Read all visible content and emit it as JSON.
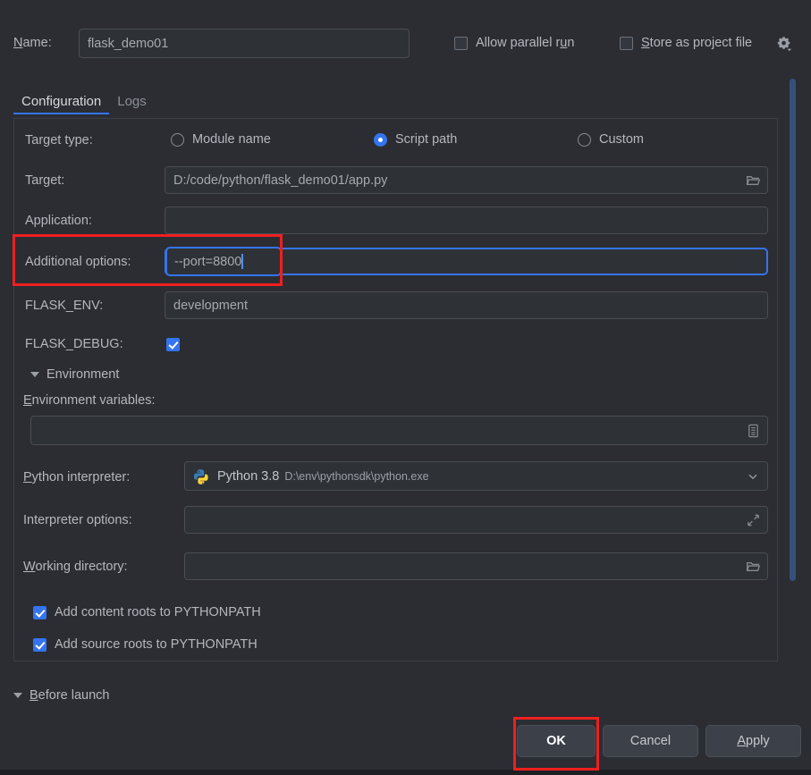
{
  "window": {
    "name_label": "Name:",
    "name_value": "flask_demo01",
    "allow_parallel_run": "Allow parallel run",
    "store_as_project_file": "Store as project file",
    "gear_icon": "gear-icon"
  },
  "tabs": [
    {
      "label": "Configuration",
      "active": true
    },
    {
      "label": "Logs",
      "active": false
    }
  ],
  "form": {
    "target_type_label": "Target type:",
    "target_type_options": [
      {
        "label": "Module name",
        "selected": false
      },
      {
        "label": "Script path",
        "selected": true
      },
      {
        "label": "Custom",
        "selected": false
      }
    ],
    "target_label": "Target:",
    "target_value": "D:/code/python/flask_demo01/app.py",
    "target_browse_icon": "folder-icon",
    "application_label": "Application:",
    "application_value": "",
    "additional_options_label": "Additional options:",
    "additional_options_value": "--port=8800",
    "flask_env_label": "FLASK_ENV:",
    "flask_env_value": "development",
    "flask_debug_label": "FLASK_DEBUG:",
    "flask_debug_checked": true,
    "environment_section_label": "Environment",
    "environment_variables_label": "Environment variables:",
    "environment_variables_value": "",
    "environment_variables_icon": "list-editor-icon",
    "python_interpreter_label": "Python interpreter:",
    "python_interpreter_name": "Python 3.8",
    "python_interpreter_path": "D:\\env\\pythonsdk\\python.exe",
    "python_interpreter_icon": "python-icon",
    "interpreter_options_label": "Interpreter options:",
    "interpreter_options_value": "",
    "interpreter_options_icon": "expand-icon",
    "working_directory_label": "Working directory:",
    "working_directory_value": "",
    "working_directory_icon": "folder-icon",
    "add_content_roots_label": "Add content roots to PYTHONPATH",
    "add_content_roots_checked": true,
    "add_source_roots_label": "Add source roots to PYTHONPATH",
    "add_source_roots_checked": true
  },
  "footer": {
    "before_launch_label": "Before launch",
    "ok_label": "OK",
    "cancel_label": "Cancel",
    "apply_label": "Apply"
  },
  "colors": {
    "accent": "#3574f0",
    "annotation": "#f01f1f",
    "background": "#2b2d33",
    "field_background": "#2e3136",
    "scrollbar": "#36507e"
  }
}
